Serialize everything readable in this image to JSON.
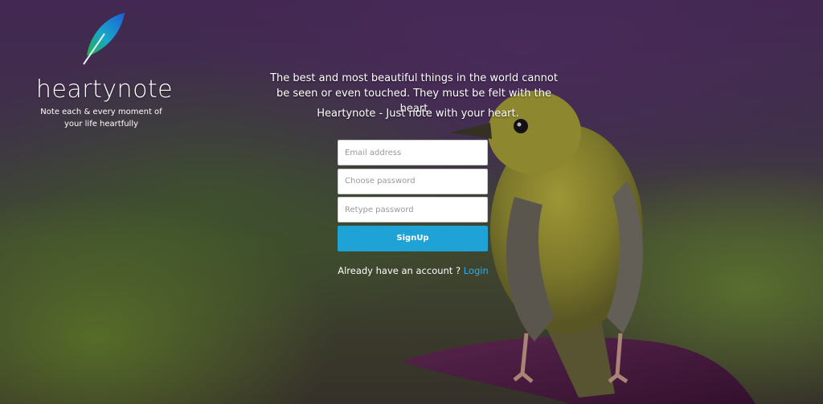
{
  "brand": {
    "name": "heartynote",
    "tagline": "Note each & every moment of your life heartfully",
    "logo_icon": "feather-icon"
  },
  "hero": {
    "quote": "The best and most beautiful things in the world cannot be seen or even touched. They must be felt with the heart",
    "slogan": "Heartynote - Just note with your heart."
  },
  "signup_form": {
    "email_placeholder": "Email address",
    "password_placeholder": "Choose password",
    "retype_placeholder": "Retype password",
    "submit_label": "SignUp"
  },
  "login_prompt": {
    "text": "Already have an account ?",
    "link_label": "Login"
  },
  "colors": {
    "button": "#1fa3d6",
    "link": "#35a8e3"
  }
}
